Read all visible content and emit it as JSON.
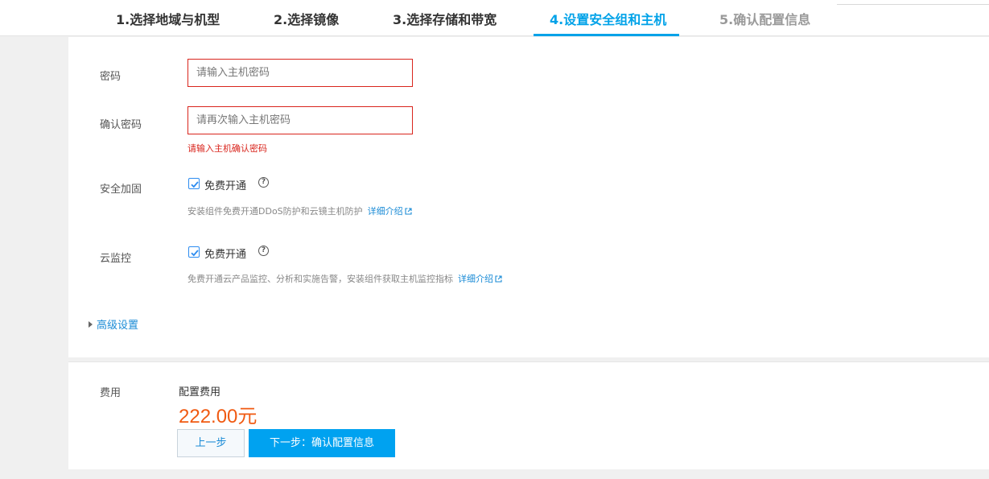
{
  "steps": [
    {
      "label": "1.选择地域与机型",
      "state": "done"
    },
    {
      "label": "2.选择镜像",
      "state": "done"
    },
    {
      "label": "3.选择存储和带宽",
      "state": "done"
    },
    {
      "label": "4.设置安全组和主机",
      "state": "active"
    },
    {
      "label": "5.确认配置信息",
      "state": "disabled"
    }
  ],
  "form": {
    "password": {
      "label": "密码",
      "placeholder": "请输入主机密码"
    },
    "confirm_password": {
      "label": "确认密码",
      "placeholder": "请再次输入主机密码",
      "error": "请输入主机确认密码"
    },
    "security": {
      "label": "安全加固",
      "checkbox_label": "免费开通",
      "checked": true,
      "help": "?",
      "desc": "安装组件免费开通DDoS防护和云镜主机防护",
      "link": "详细介绍"
    },
    "monitor": {
      "label": "云监控",
      "checkbox_label": "免费开通",
      "checked": true,
      "help": "?",
      "desc": "免费开通云产品监控、分析和实施告警，安装组件获取主机监控指标",
      "link": "详细介绍"
    },
    "advanced": "高级设置"
  },
  "cost": {
    "label": "费用",
    "sublabel": "配置费用",
    "amount": "222.00元"
  },
  "buttons": {
    "prev": "上一步",
    "next": "下一步：确认配置信息"
  },
  "colors": {
    "accent": "#00a2e8",
    "error": "#d9251d",
    "price": "#f05a12",
    "link": "#1a8bd6"
  }
}
